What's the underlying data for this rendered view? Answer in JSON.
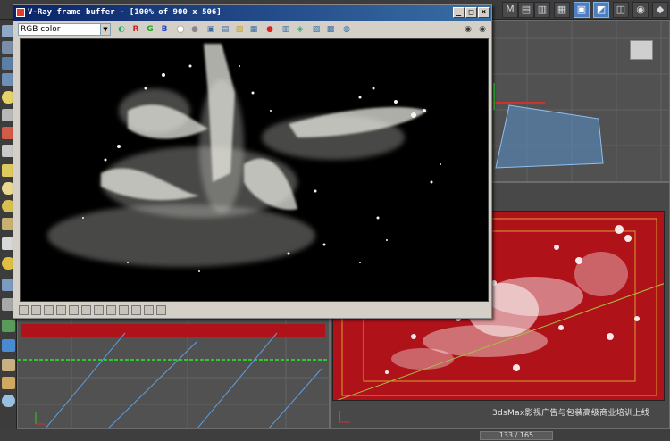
{
  "vfb": {
    "title": "V-Ray frame buffer - [100% of 900 x 506]",
    "channel": "RGB color",
    "channel_options": [
      "RGB color"
    ],
    "red_label": "R",
    "green_label": "G",
    "blue_label": "B",
    "minimize_label": "_",
    "maximize_label": "□",
    "close_label": "×"
  },
  "watermark": {
    "text": "3dsMax影视广告与包装高级商业培训上线"
  },
  "timeline": {
    "frame_readout": "133 / 165"
  },
  "colors": {
    "render_red": "#b0121a",
    "gizmo_blue": "#5aa0e6",
    "viewport_grey": "#515151"
  }
}
